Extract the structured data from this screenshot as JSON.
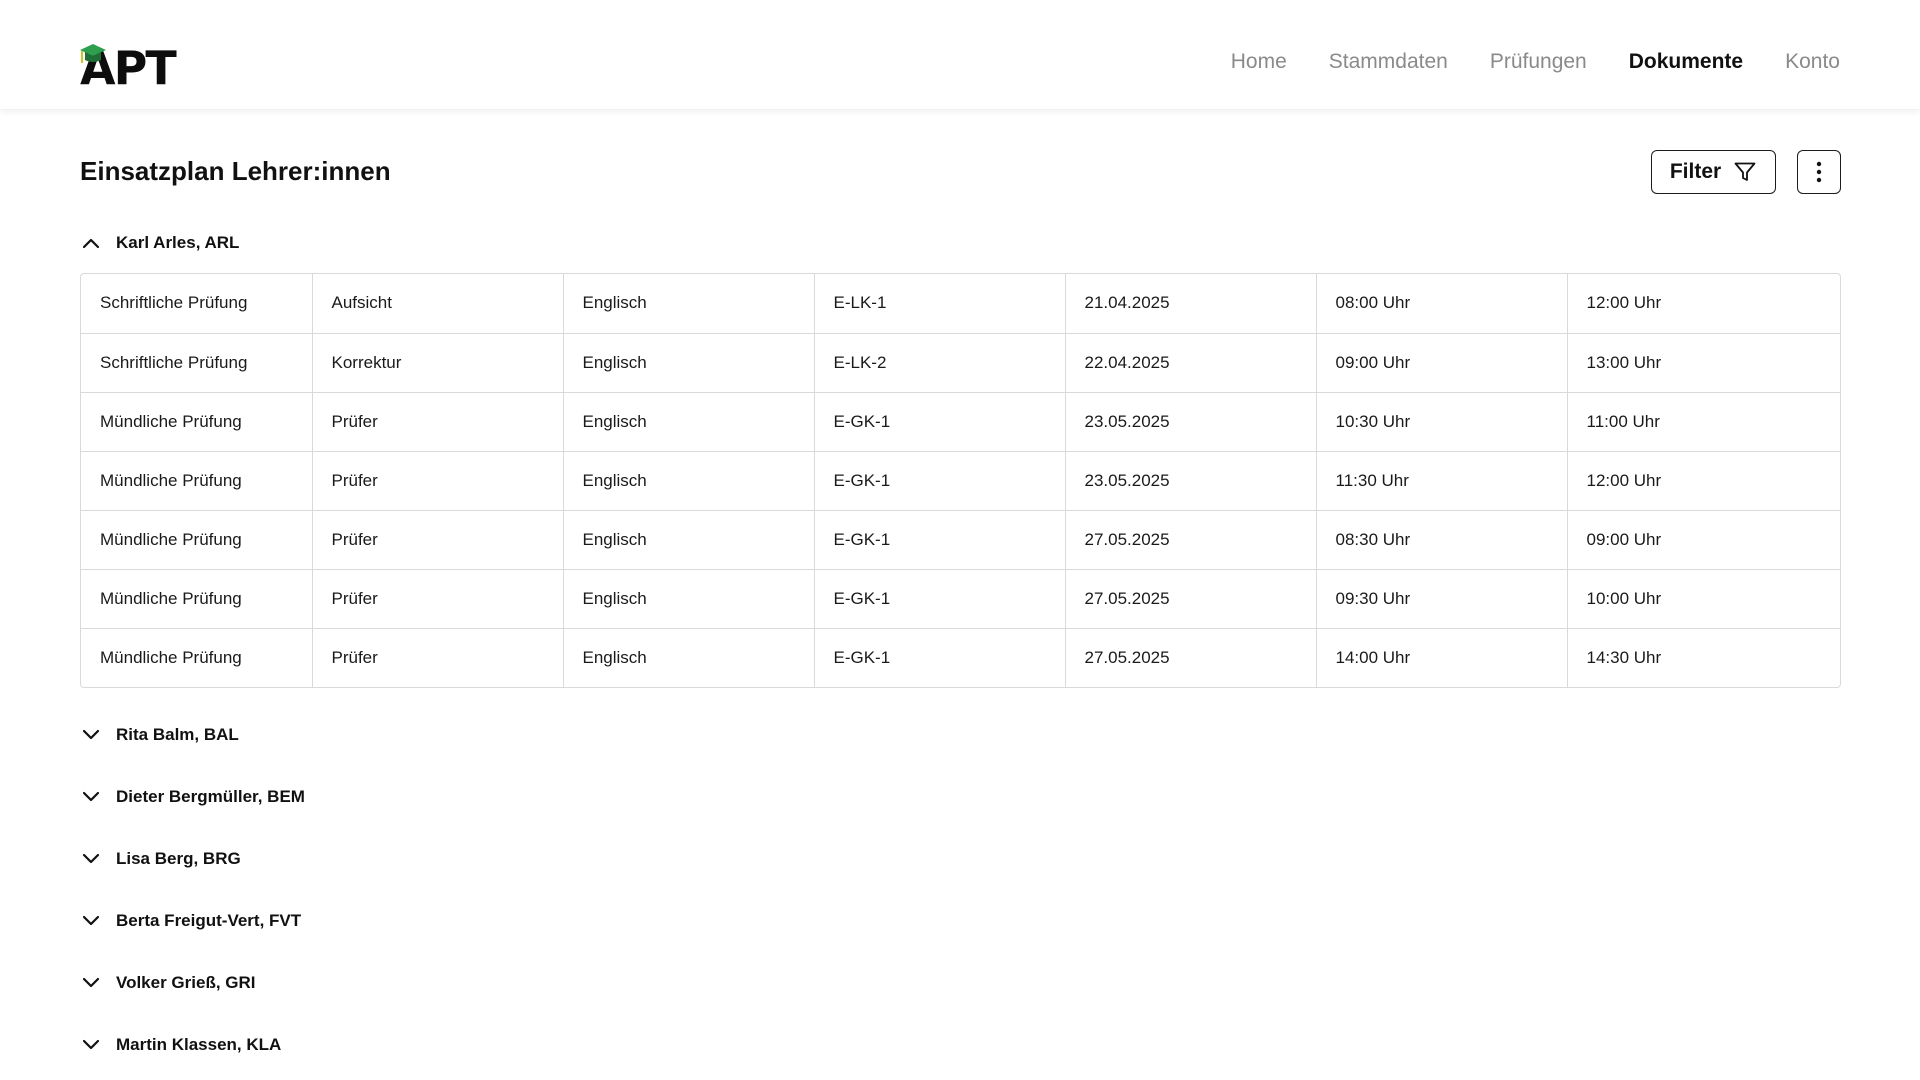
{
  "app": {
    "logo_text": "APT",
    "brand_colors": {
      "cap_green": "#2e9e4f",
      "cap_dark": "#1f6e36",
      "tassel": "#c9c43a"
    }
  },
  "nav": {
    "items": [
      {
        "label": "Home",
        "active": false
      },
      {
        "label": "Stammdaten",
        "active": false
      },
      {
        "label": "Prüfungen",
        "active": false
      },
      {
        "label": "Dokumente",
        "active": true
      },
      {
        "label": "Konto",
        "active": false
      }
    ]
  },
  "page": {
    "title": "Einsatzplan Lehrer:innen",
    "filter_label": "Filter"
  },
  "groups": [
    {
      "label": "Karl Arles, ARL",
      "expanded": true,
      "rows": [
        [
          "Schriftliche Prüfung",
          "Aufsicht",
          "Englisch",
          "E-LK-1",
          "21.04.2025",
          "08:00 Uhr",
          "12:00 Uhr"
        ],
        [
          "Schriftliche Prüfung",
          "Korrektur",
          "Englisch",
          "E-LK-2",
          "22.04.2025",
          "09:00 Uhr",
          "13:00 Uhr"
        ],
        [
          "Mündliche Prüfung",
          "Prüfer",
          "Englisch",
          "E-GK-1",
          "23.05.2025",
          "10:30 Uhr",
          "11:00 Uhr"
        ],
        [
          "Mündliche Prüfung",
          "Prüfer",
          "Englisch",
          "E-GK-1",
          "23.05.2025",
          "11:30 Uhr",
          "12:00 Uhr"
        ],
        [
          "Mündliche Prüfung",
          "Prüfer",
          "Englisch",
          "E-GK-1",
          "27.05.2025",
          "08:30 Uhr",
          "09:00 Uhr"
        ],
        [
          "Mündliche Prüfung",
          "Prüfer",
          "Englisch",
          "E-GK-1",
          "27.05.2025",
          "09:30 Uhr",
          "10:00 Uhr"
        ],
        [
          "Mündliche Prüfung",
          "Prüfer",
          "Englisch",
          "E-GK-1",
          "27.05.2025",
          "14:00 Uhr",
          "14:30 Uhr"
        ]
      ]
    },
    {
      "label": "Rita Balm, BAL",
      "expanded": false
    },
    {
      "label": "Dieter Bergmüller, BEM",
      "expanded": false
    },
    {
      "label": "Lisa Berg, BRG",
      "expanded": false
    },
    {
      "label": "Berta Freigut-Vert, FVT",
      "expanded": false
    },
    {
      "label": "Volker Grieß, GRI",
      "expanded": false
    },
    {
      "label": "Martin Klassen, KLA",
      "expanded": false
    }
  ]
}
